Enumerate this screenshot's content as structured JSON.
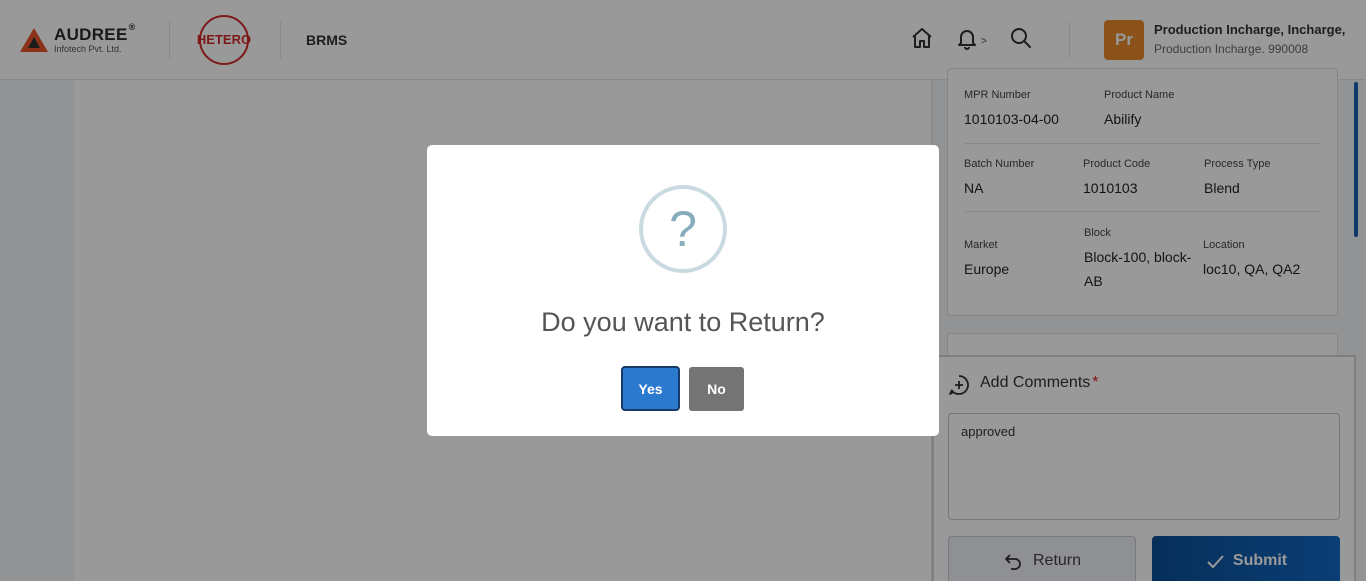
{
  "header": {
    "company_name": "AUDREE",
    "company_reg": "®",
    "company_sub": "Infotech Pvt. Ltd.",
    "client_name": "HETERO",
    "app_name": "BRMS",
    "bell_chevron": ">",
    "user": {
      "avatar_initials": "Pr",
      "line1": "Production Incharge, Incharge,",
      "line2": "Production Incharge. 990008",
      "avatar_color": "#e8892a"
    }
  },
  "info": {
    "mpr_number": {
      "label": "MPR Number",
      "value": "1010103-04-00"
    },
    "product_name": {
      "label": "Product Name",
      "value": "Abilify"
    },
    "batch_number": {
      "label": "Batch Number",
      "value": "NA"
    },
    "product_code": {
      "label": "Product Code",
      "value": "1010103"
    },
    "process_type": {
      "label": "Process Type",
      "value": "Blend"
    },
    "market": {
      "label": "Market",
      "value": "Europe"
    },
    "block": {
      "label": "Block",
      "value": "Block-100, block-AB"
    },
    "location": {
      "label": "Location",
      "value": "loc10, QA, QA2"
    }
  },
  "comments": {
    "title": "Add Comments",
    "required_mark": "*",
    "value": "approved"
  },
  "actions": {
    "return_label": "Return",
    "submit_label": "Submit"
  },
  "modal": {
    "icon_glyph": "?",
    "title": "Do you want to Return?",
    "yes_label": "Yes",
    "no_label": "No"
  },
  "colors": {
    "primary": "#1268c4",
    "yes_button": "#2b7ad0",
    "no_button": "#747474",
    "required": "#d8221c"
  }
}
